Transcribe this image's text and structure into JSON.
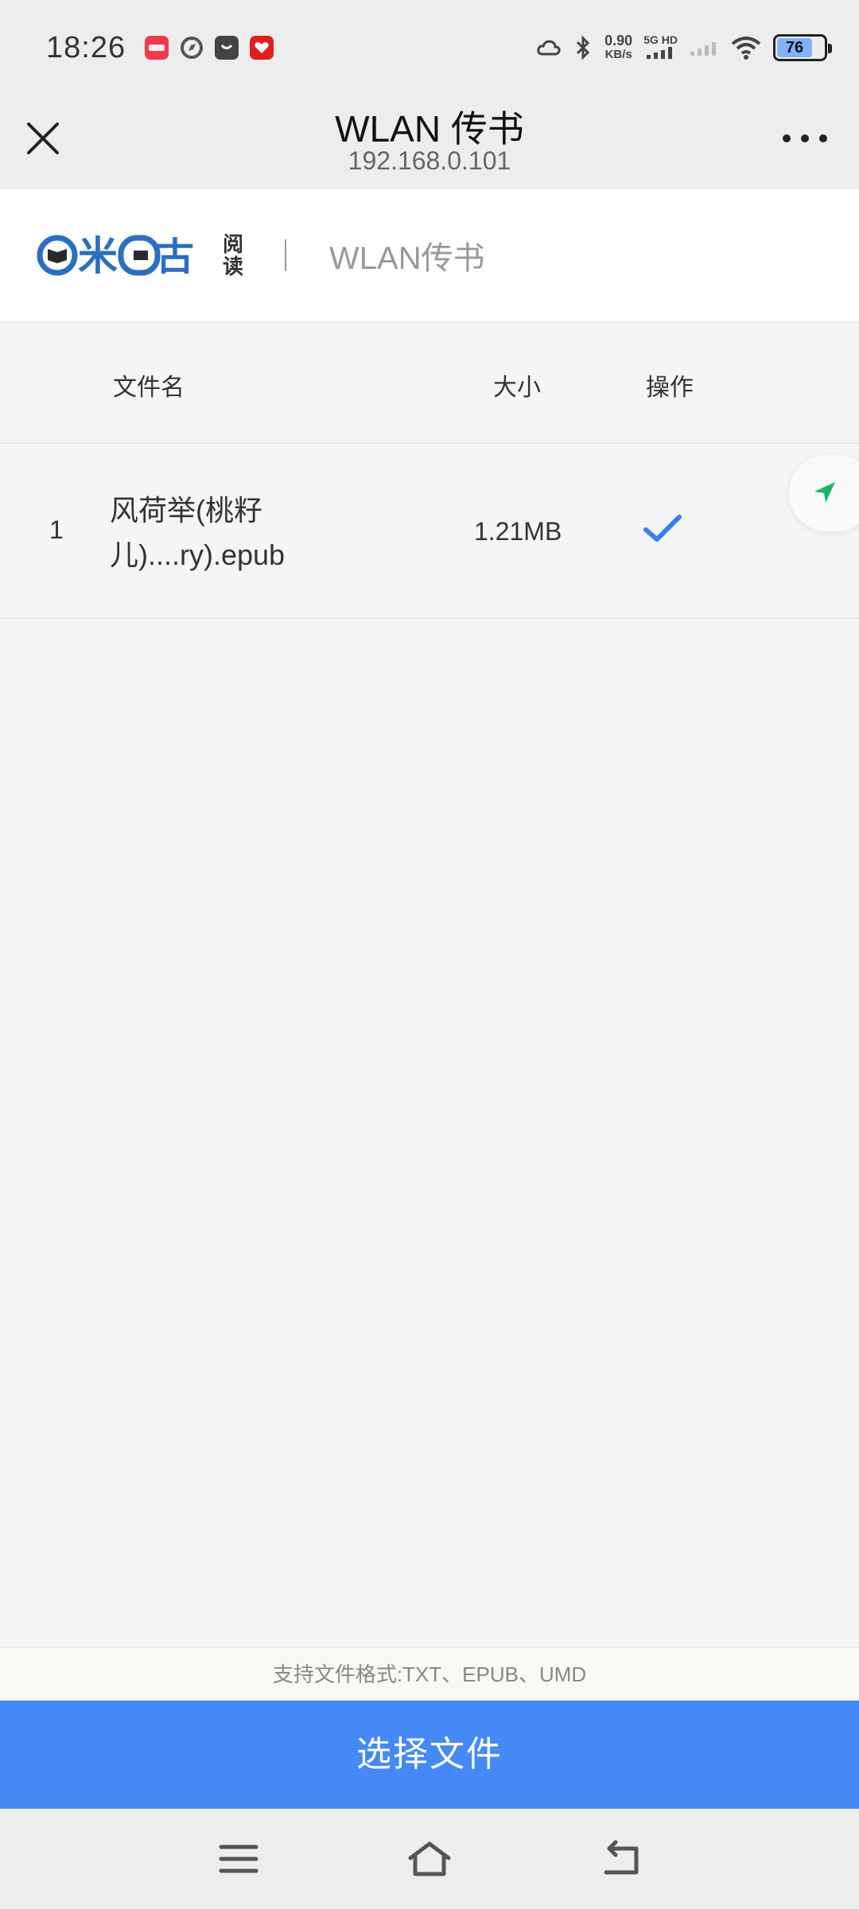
{
  "status_bar": {
    "time": "18:26",
    "speed_value": "0.90",
    "speed_unit": "KB/s",
    "network": "5G HD",
    "battery": "76",
    "battery_level": 0.76,
    "icons": [
      "notification-app-icon",
      "compass-app-icon",
      "shopping-bag-icon",
      "heart-app-icon",
      "cloud-icon",
      "bluetooth-icon",
      "signal-icon",
      "wifi-icon",
      "battery-icon"
    ]
  },
  "titlebar": {
    "title": "WLAN 传书",
    "subtitle": "192.168.0.101"
  },
  "brand": {
    "logo_text": "咪咕阅读",
    "section_title": "WLAN传书"
  },
  "table": {
    "headers": {
      "name": "文件名",
      "size": "大小",
      "action": "操作"
    },
    "rows": [
      {
        "index": "1",
        "name": "风荷举(桃籽儿)....ry).epub",
        "size": "1.21MB",
        "action_icon": "checkmark-icon"
      }
    ]
  },
  "footer": {
    "formats_text": "支持文件格式:TXT、EPUB、UMD",
    "choose_button": "选择文件"
  },
  "colors": {
    "accent": "#4489f5",
    "check": "#3a7ff0",
    "logo_blue": "#2a6fc0",
    "float_arrow": "#1fb26b"
  }
}
